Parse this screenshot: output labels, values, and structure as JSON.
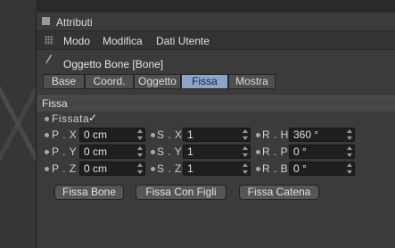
{
  "panel": {
    "title": "Attributi"
  },
  "menu": {
    "items": [
      "Modo",
      "Modifica",
      "Dati Utente"
    ]
  },
  "object": {
    "title": "Oggetto Bone [Bone]"
  },
  "tabs": [
    {
      "label": "Base",
      "active": false
    },
    {
      "label": "Coord.",
      "active": false
    },
    {
      "label": "Oggetto",
      "active": false
    },
    {
      "label": "Fissa",
      "active": true
    },
    {
      "label": "Mostra",
      "active": false
    }
  ],
  "section": {
    "title": "Fissa"
  },
  "fixed": {
    "label": "Fissata",
    "check": "✓"
  },
  "params": {
    "px": {
      "label": "P . X",
      "value": "0 cm"
    },
    "py": {
      "label": "P . Y",
      "value": "0 cm"
    },
    "pz": {
      "label": "P . Z",
      "value": "0 cm"
    },
    "sx": {
      "label": "S . X",
      "value": "1"
    },
    "sy": {
      "label": "S . Y",
      "value": "1"
    },
    "sz": {
      "label": "S . Z",
      "value": "1"
    },
    "rh": {
      "label": "R . H",
      "value": "360 °"
    },
    "rp": {
      "label": "R . P",
      "value": "0 °"
    },
    "rb": {
      "label": "R . B",
      "value": "0 °"
    }
  },
  "buttons": [
    "Fissa Bone",
    "Fissa Con Figli",
    "Fissa Catena"
  ],
  "colors": {
    "active_tab": "#8da4c9",
    "panel_bg": "#3b3b3b"
  }
}
